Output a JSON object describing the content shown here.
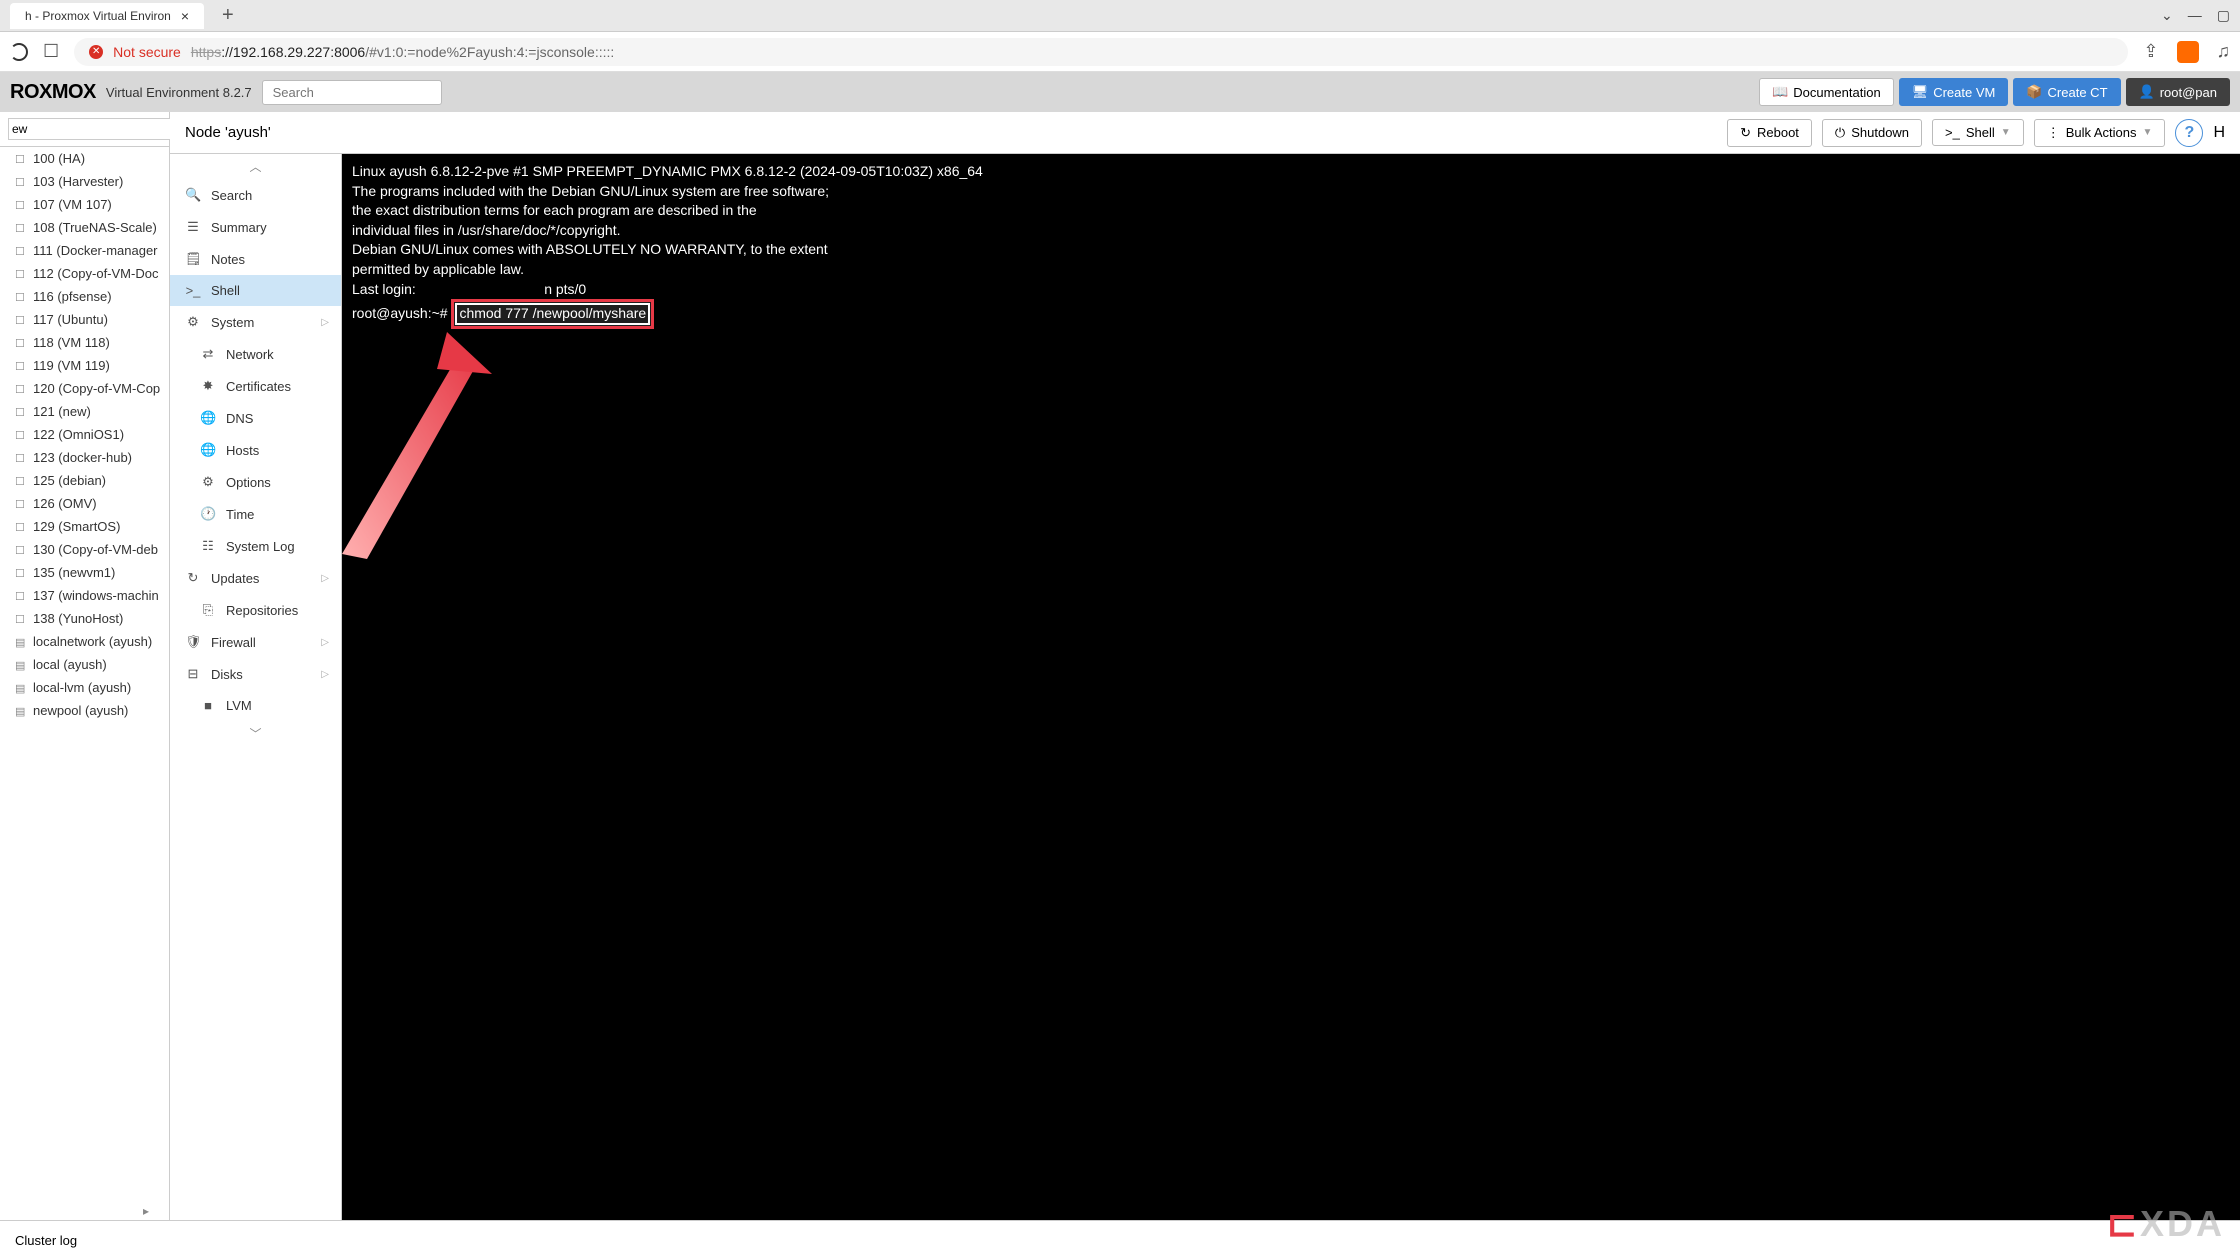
{
  "browser": {
    "tab_title": "h - Proxmox Virtual Environ",
    "not_secure": "Not secure",
    "url_proto": "https",
    "url_host": "://192.168.29.227:8006",
    "url_path": "/#v1:0:=node%2Fayush:4:=jsconsole:::::"
  },
  "pm": {
    "logo": "ROXMOX",
    "subtitle": "Virtual Environment 8.2.7",
    "search_placeholder": "Search",
    "doc": "Documentation",
    "create_vm": "Create VM",
    "create_ct": "Create CT",
    "user": "root@pan"
  },
  "tree": {
    "view": "ew",
    "items": [
      "100 (HA)",
      "103 (Harvester)",
      "107 (VM 107)",
      "108 (TrueNAS-Scale)",
      "111 (Docker-manager",
      "112 (Copy-of-VM-Doc",
      "116 (pfsense)",
      "117 (Ubuntu)",
      "118 (VM 118)",
      "119 (VM 119)",
      "120 (Copy-of-VM-Cop",
      "121 (new)",
      "122 (OmniOS1)",
      "123 (docker-hub)",
      "125 (debian)",
      "126 (OMV)",
      "129 (SmartOS)",
      "130 (Copy-of-VM-deb",
      "135 (newvm1)",
      "137 (windows-machin",
      "138 (YunoHost)",
      "localnetwork (ayush)",
      "local (ayush)",
      "local-lvm (ayush)",
      "newpool (ayush)"
    ]
  },
  "node": {
    "title": "Node 'ayush'",
    "reboot": "Reboot",
    "shutdown": "Shutdown",
    "shell": "Shell",
    "bulk": "Bulk Actions",
    "help": "H"
  },
  "nav": [
    {
      "icon": "🔍",
      "label": "Search"
    },
    {
      "icon": "☰",
      "label": "Summary"
    },
    {
      "icon": "🗒",
      "label": "Notes"
    },
    {
      "icon": ">_",
      "label": "Shell",
      "active": true
    },
    {
      "icon": "⚙",
      "label": "System",
      "expand": true
    },
    {
      "icon": "⇄",
      "label": "Network",
      "sub": true
    },
    {
      "icon": "✸",
      "label": "Certificates",
      "sub": true
    },
    {
      "icon": "🌐",
      "label": "DNS",
      "sub": true
    },
    {
      "icon": "🌐",
      "label": "Hosts",
      "sub": true
    },
    {
      "icon": "⚙",
      "label": "Options",
      "sub": true
    },
    {
      "icon": "🕐",
      "label": "Time",
      "sub": true
    },
    {
      "icon": "☷",
      "label": "System Log",
      "sub": true
    },
    {
      "icon": "↻",
      "label": "Updates",
      "expand": true
    },
    {
      "icon": "⎘",
      "label": "Repositories",
      "sub": true
    },
    {
      "icon": "🛡",
      "label": "Firewall",
      "expand": true
    },
    {
      "icon": "⊟",
      "label": "Disks",
      "expand": true
    },
    {
      "icon": "■",
      "label": "LVM",
      "sub": true
    }
  ],
  "terminal": {
    "l1": "Linux ayush 6.8.12-2-pve #1 SMP PREEMPT_DYNAMIC PMX 6.8.12-2 (2024-09-05T10:03Z) x86_64",
    "l2": "",
    "l3": "The programs included with the Debian GNU/Linux system are free software;",
    "l4": "the exact distribution terms for each program are described in the",
    "l5": "individual files in /usr/share/doc/*/copyright.",
    "l6": "",
    "l7": "Debian GNU/Linux comes with ABSOLUTELY NO WARRANTY, to the extent",
    "l8": "permitted by applicable law.",
    "l9a": "Last login: ",
    "l9b": "n pts/0",
    "prompt": "root@ayush:~#",
    "cmd": "chmod 777 /newpool/myshare"
  },
  "bottom": {
    "cluster_log": "Cluster log"
  },
  "watermark": {
    "text": "XDA"
  }
}
